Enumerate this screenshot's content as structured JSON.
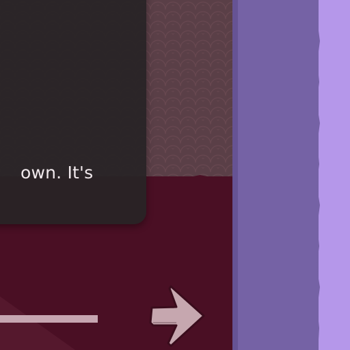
{
  "dialog": {
    "text": "own. It's"
  },
  "progress": {
    "value_fraction": 1.0
  },
  "navigation": {
    "next_icon": "arrow-right-icon"
  },
  "colors": {
    "floor": "#4a0f24",
    "dialog_bg": "#282426",
    "progress": "#c7a6b1",
    "arrow": "#c6a7af",
    "column_mid": "#7562a5",
    "column_right": "#b597ea"
  }
}
